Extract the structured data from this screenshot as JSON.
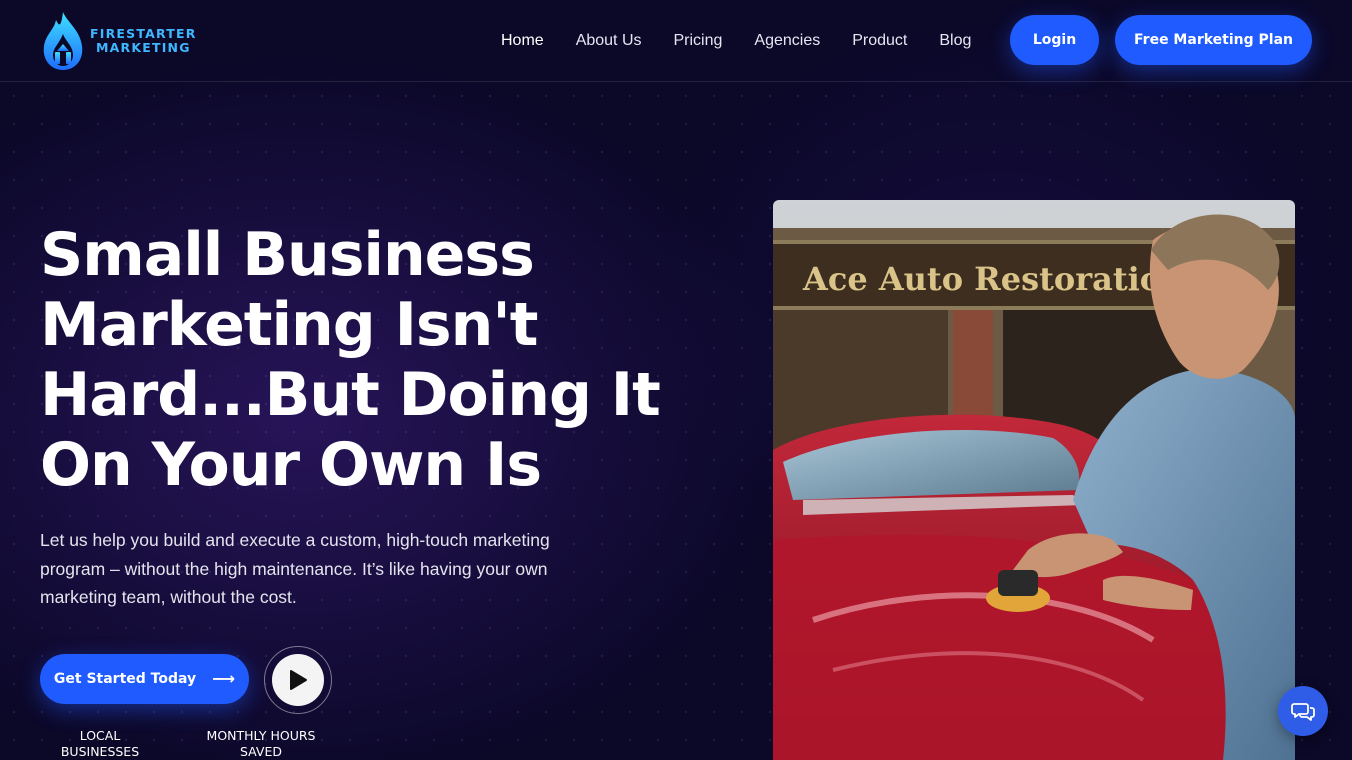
{
  "brand": {
    "line1": "FIRESTARTER",
    "line2": "MARKETING"
  },
  "nav": {
    "items": [
      {
        "label": "Home"
      },
      {
        "label": "About Us"
      },
      {
        "label": "Pricing"
      },
      {
        "label": "Agencies"
      },
      {
        "label": "Product"
      },
      {
        "label": "Blog"
      }
    ],
    "login_label": "Login",
    "plan_label": "Free Marketing Plan"
  },
  "hero": {
    "title": "Small Business Marketing Isn't Hard...But Doing It On Your Own Is",
    "subtitle": "Let us help you build and execute a custom, high-touch marketing program – without the high maintenance. It’s like having your own marketing team, without the cost.",
    "cta_label": "Get Started Today",
    "stats": [
      {
        "label": "LOCAL BUSINESSES"
      },
      {
        "label": "MONTHLY HOURS SAVED"
      }
    ]
  },
  "photo": {
    "sign_text": "Ace Auto Restoration"
  },
  "icons": {
    "logo": "flame-logo-icon",
    "arrow": "arrow-right-icon",
    "play": "play-icon",
    "chat": "chat-bubbles-icon"
  },
  "colors": {
    "background": "#0b0828",
    "accent": "#1f5bff",
    "brand_text": "#3fb7ff"
  }
}
